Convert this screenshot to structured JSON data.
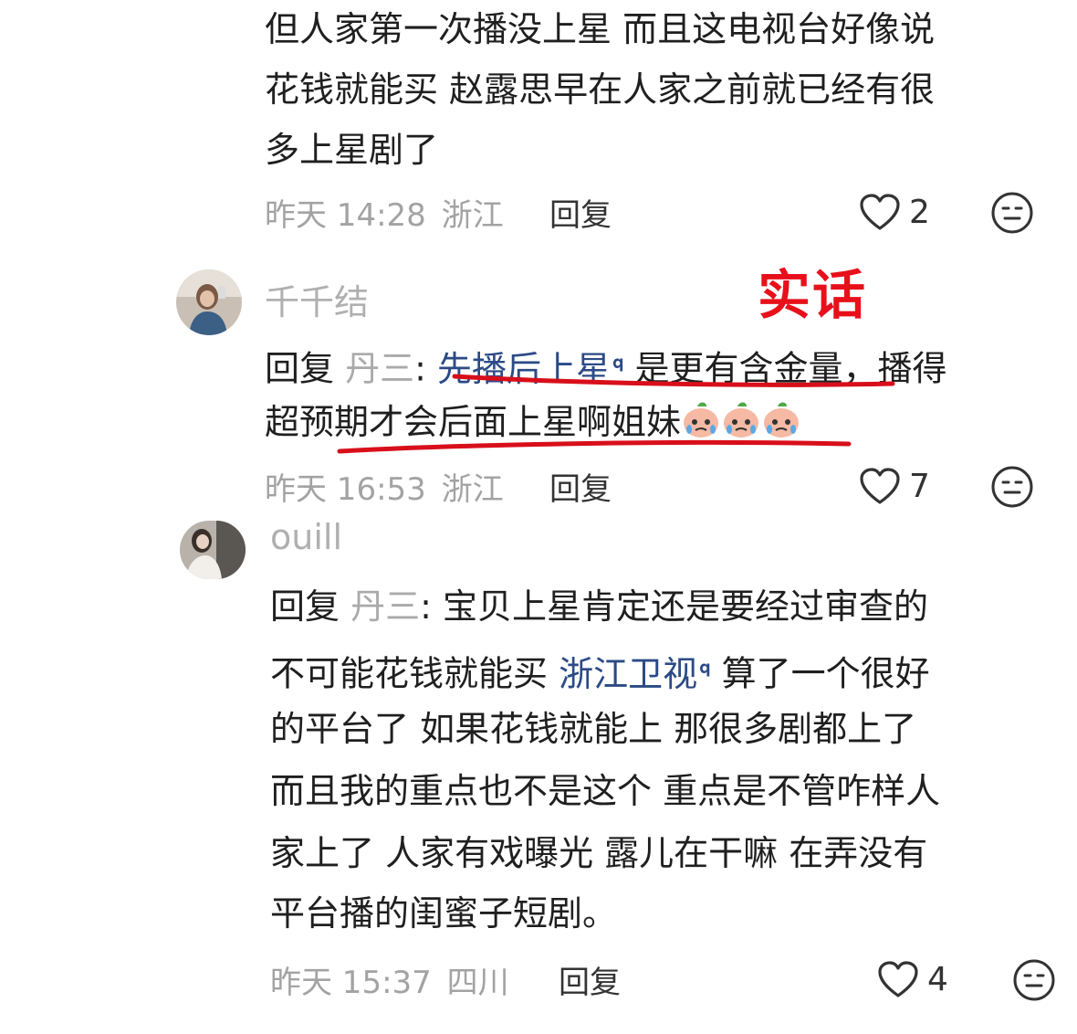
{
  "comments": [
    {
      "lines": [
        "但人家第一次播没上星 而且这电视台好像说",
        "花钱就能买 赵露思早在人家之前就已经有很",
        "多上星剧了"
      ],
      "time": "昨天 14:28",
      "location": "浙江",
      "reply_label": "回复",
      "likes": "2"
    },
    {
      "username": "千千结",
      "reply_prefix": "回复",
      "reply_to": "丹三",
      "link_text": "先播后上星",
      "line1_rest": "是更有含金量，播得",
      "line2": "超预期才会后面上星啊姐妹",
      "time": "昨天 16:53",
      "location": "浙江",
      "reply_label": "回复",
      "likes": "7"
    },
    {
      "username": "ouill",
      "reply_prefix": "回复",
      "reply_to": "丹三",
      "line1_rest": "宝贝上星肯定还是要经过审查的",
      "line2_pre": "不可能花钱就能买",
      "link_text": "浙江卫视",
      "line2_post": "算了一个很好",
      "lines_rest": [
        "的平台了 如果花钱就能上 那很多剧都上了",
        "而且我的重点也不是这个 重点是不管咋样人",
        "家上了 人家有戏曝光 露儿在干嘛 在弄没有",
        "平台播的闺蜜子短剧。"
      ],
      "time": "昨天 15:37",
      "location": "四川",
      "reply_label": "回复",
      "likes": "4"
    }
  ],
  "annotation": {
    "text": "实话",
    "color": "#e8101a"
  },
  "icons": {
    "like": "heart-outline-icon",
    "dislike": "neutral-face-icon",
    "search": "search-icon",
    "emoji": "crying-peach-emoji"
  },
  "colors": {
    "link": "#2b4a86",
    "underline": "#d80f1a",
    "meta": "#a3a3a3"
  }
}
